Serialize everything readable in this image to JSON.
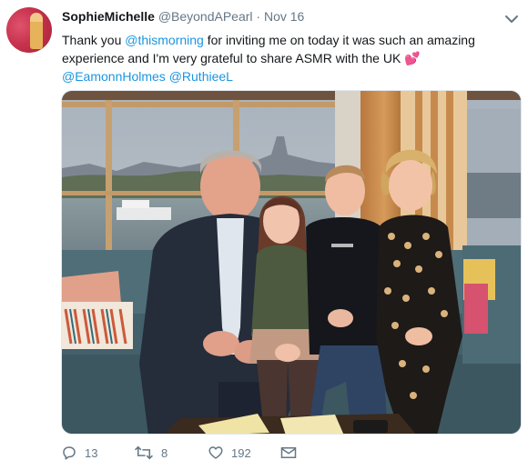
{
  "tweet": {
    "author_name": "SophieMichelle",
    "author_handle": "@BeyondAPearl",
    "separator": "·",
    "date": "Nov 16",
    "text_part1": "Thank you ",
    "mention_1": "@thismorning",
    "text_part2": " for inviting me on today it was such an amazing experience and I'm very grateful to share ASMR with the UK ",
    "emoji": "💕",
    "mention_2": "@EamonnHolmes",
    "mention_3": "@RuthieeL"
  },
  "actions": {
    "reply_count": "13",
    "retweet_count": "8",
    "like_count": "192"
  },
  "icons": {
    "reply": "reply-icon",
    "retweet": "retweet-icon",
    "like": "heart-icon",
    "dm": "envelope-icon",
    "more": "chevron-down-icon"
  },
  "colors": {
    "link": "#1b95e0",
    "muted": "#657786",
    "text": "#14171a"
  }
}
